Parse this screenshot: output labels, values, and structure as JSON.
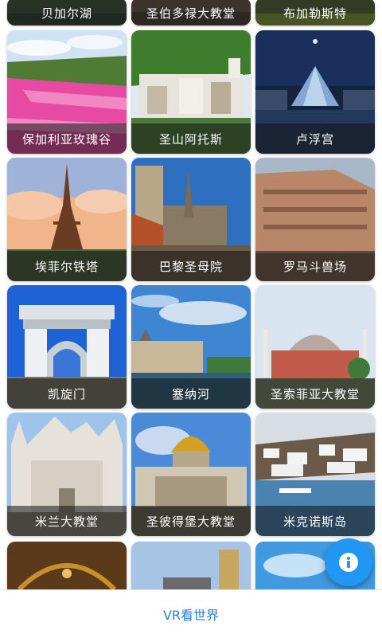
{
  "grid": {
    "top_row": [
      "贝加尔湖",
      "圣伯多禄大教堂",
      "布加勒斯特"
    ],
    "rows": [
      [
        "保加利亚玫瑰谷",
        "圣山阿托斯",
        "卢浮宫"
      ],
      [
        "埃菲尔铁塔",
        "巴黎圣母院",
        "罗马斗兽场"
      ],
      [
        "凯旋门",
        "塞纳河",
        "圣索菲亚大教堂"
      ],
      [
        "米兰大教堂",
        "圣彼得堡大教堂",
        "米克诺斯岛"
      ]
    ]
  },
  "fab": {
    "icon": "info-icon",
    "color": "#2196F3"
  },
  "bottom_nav": {
    "tab_label": "VR看世界",
    "accent": "#2a7fd4"
  }
}
